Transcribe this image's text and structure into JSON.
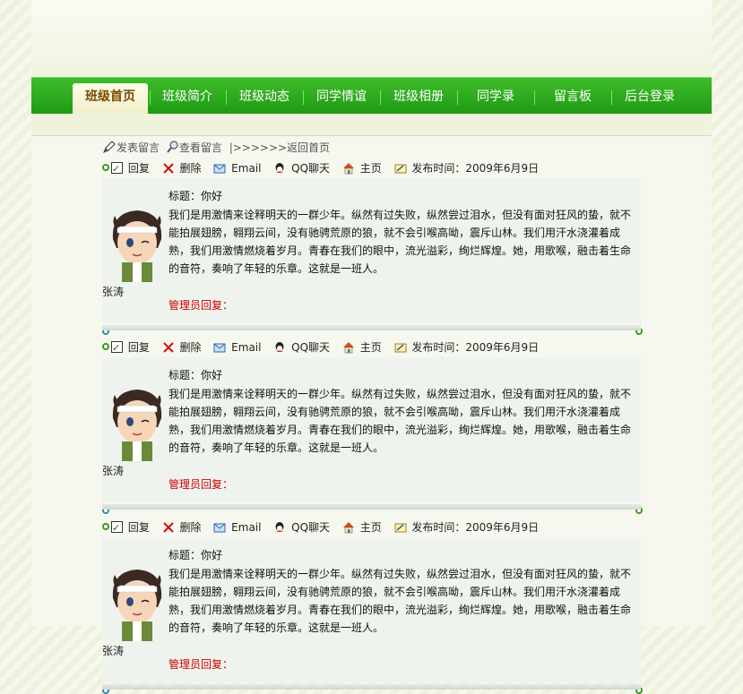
{
  "nav": {
    "items": [
      "班级首页",
      "班级简介",
      "班级动态",
      "同学情谊",
      "班级相册",
      "同学录",
      "留言板",
      "后台登录"
    ]
  },
  "toolbar": {
    "post": "发表留言",
    "view": "查看留言",
    "back": "|>>>>>>返回首页"
  },
  "entries": [
    {
      "reply": "回复",
      "delete": "删除",
      "email": "Email",
      "qq": "QQ聊天",
      "home": "主页",
      "date": "发布时间：2009年6月9日",
      "title": "标题：你好",
      "content": "我们是用激情来诠释明天的一群少年。纵然有过失败，纵然尝过泪水，但没有面对狂风的蛰，就不能拍展翅膀，翱翔云间，没有驰骋荒原的狼，就不会引喉高呦，震斥山林。我们用汗水浇灌着成熟，我们用激情燃烧着岁月。青春在我们的眼中，流光溢彩，绚烂辉煌。她，用歌喉，融击着生命的音符，奏响了年轻的乐章。这就是一班人。",
      "user": "张涛",
      "admin_reply": "管理员回复："
    },
    {
      "reply": "回复",
      "delete": "删除",
      "email": "Email",
      "qq": "QQ聊天",
      "home": "主页",
      "date": "发布时间：2009年6月9日",
      "title": "标题：你好",
      "content": "我们是用激情来诠释明天的一群少年。纵然有过失败，纵然尝过泪水，但没有面对狂风的蛰，就不能拍展翅膀，翱翔云间，没有驰骋荒原的狼，就不会引喉高呦，震斥山林。我们用汗水浇灌着成熟，我们用激情燃烧着岁月。青春在我们的眼中，流光溢彩，绚烂辉煌。她，用歌喉，融击着生命的音符，奏响了年轻的乐章。这就是一班人。",
      "user": "张涛",
      "admin_reply": "管理员回复："
    },
    {
      "reply": "回复",
      "delete": "删除",
      "email": "Email",
      "qq": "QQ聊天",
      "home": "主页",
      "date": "发布时间：2009年6月9日",
      "title": "标题：你好",
      "content": "我们是用激情来诠释明天的一群少年。纵然有过失败，纵然尝过泪水，但没有面对狂风的蛰，就不能拍展翅膀，翱翔云间，没有驰骋荒原的狼，就不会引喉高呦，震斥山林。我们用汗水浇灌着成熟，我们用激情燃烧着岁月。青春在我们的眼中，流光溢彩，绚烂辉煌。她，用歌喉，融击着生命的音符，奏响了年轻的乐章。这就是一班人。",
      "user": "张涛",
      "admin_reply": "管理员回复："
    }
  ],
  "colors": {
    "nav_green": "#1f9a14",
    "admin_red": "#cc0000",
    "dot_green": "#3a9a20",
    "dot_teal": "#2a8fa0"
  },
  "icons": [
    "checkbox-icon",
    "delete-x-icon",
    "email-icon",
    "qq-icon",
    "home-icon",
    "date-icon",
    "pen-icon",
    "magnifier-icon"
  ]
}
